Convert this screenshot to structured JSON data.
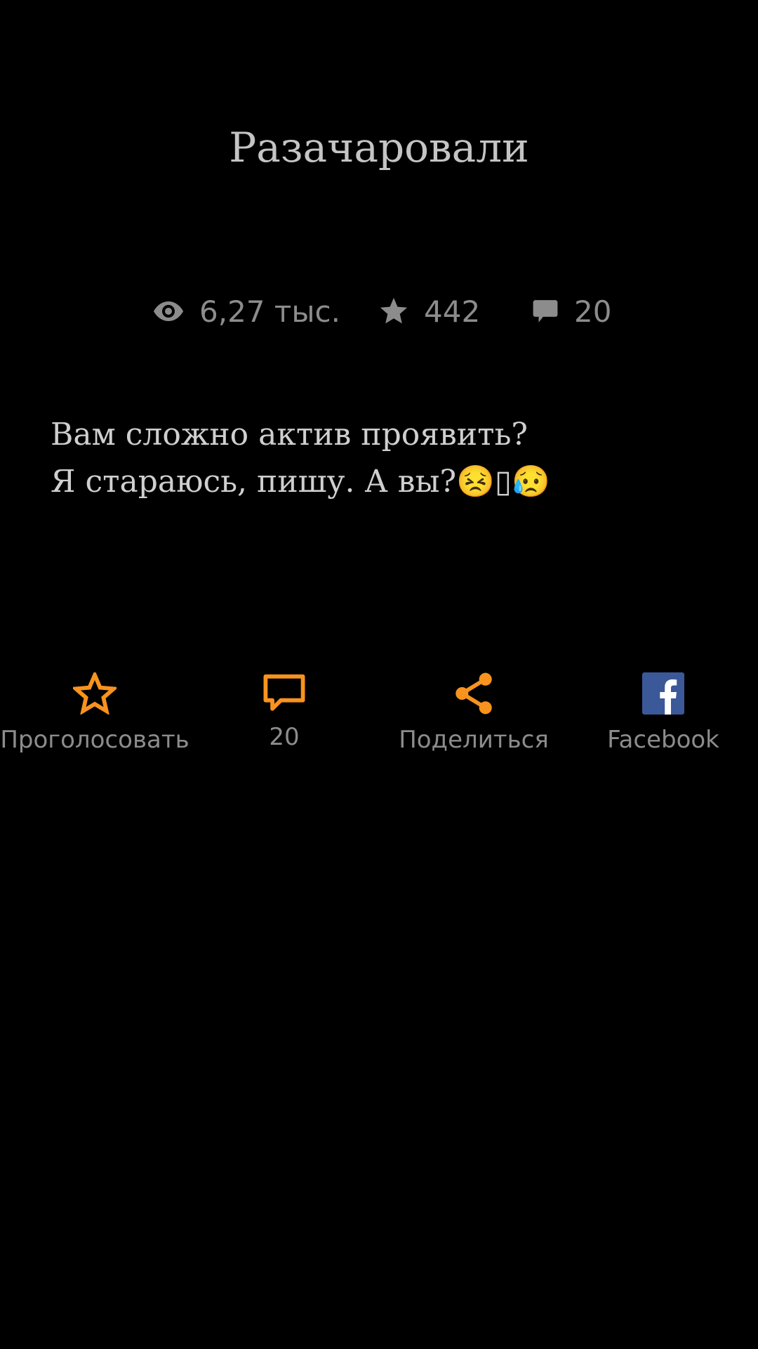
{
  "post": {
    "title": "Разачаровали",
    "body_lines": [
      "Вам сложно актив проявить?",
      "Я стараюсь, пишу. А вы?😣▯😥"
    ]
  },
  "stats": {
    "views": "6,27 тыс.",
    "stars": "442",
    "comments": "20"
  },
  "actions": {
    "vote_label": "Проголосовать",
    "comments_label": "20",
    "share_label": "Поделиться",
    "facebook_label": "Facebook"
  },
  "icons": {
    "views": "eye-icon",
    "stars": "star-icon",
    "comments": "comment-icon",
    "vote": "star-outline-icon",
    "comment_action": "comment-outline-icon",
    "share": "share-icon",
    "facebook": "facebook-icon"
  },
  "colors": {
    "background": "#000000",
    "accent": "#f7931e",
    "stat_gray": "#8c8c8c",
    "title_text": "#c4c4c4",
    "facebook_blue": "#3b5998"
  }
}
